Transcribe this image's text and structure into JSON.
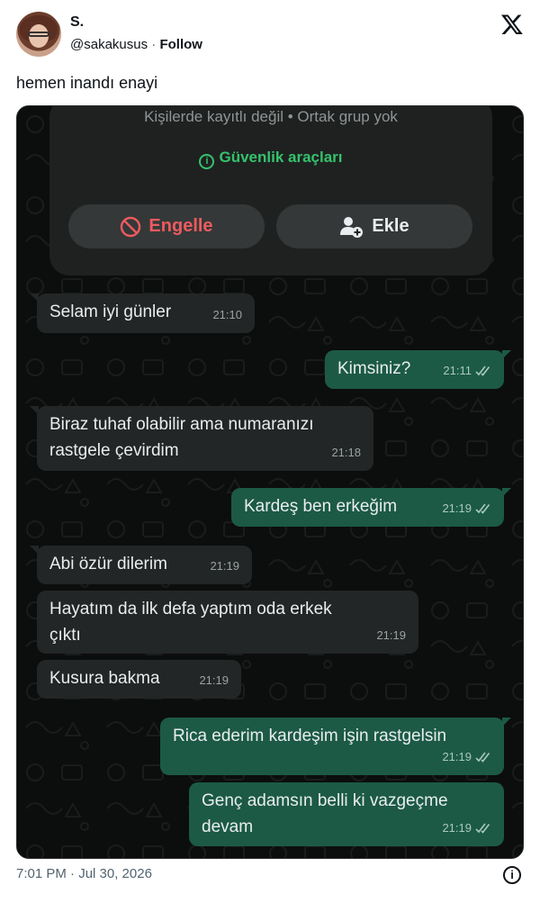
{
  "tweet": {
    "display_name": "S.",
    "handle": "@sakakusus",
    "separator": "·",
    "follow_label": "Follow",
    "text": "hemen inandı enayi",
    "timestamp": "7:01 PM · Jul 30, 2026"
  },
  "chat": {
    "contact_info": "Kişilerde kayıtlı değil • Ortak grup yok",
    "security_label": "Güvenlik araçları",
    "block_label": "Engelle",
    "add_label": "Ekle",
    "messages": [
      {
        "dir": "in",
        "text": "Selam iyi günler",
        "time": "21:10"
      },
      {
        "dir": "out",
        "text": "Kimsiniz?",
        "time": "21:11"
      },
      {
        "dir": "in",
        "text": "Biraz tuhaf olabilir ama numaranızı rastgele çevirdim",
        "line1": "Biraz tuhaf olabilir ama numaranızı",
        "line2": "rastgele çevirdim",
        "time": "21:18"
      },
      {
        "dir": "out",
        "text": "Kardeş ben erkeğim",
        "time": "21:19"
      },
      {
        "dir": "in",
        "text": "Abi özür dilerim",
        "time": "21:19"
      },
      {
        "dir": "in",
        "text": "Hayatım da ilk defa yaptım oda erkek çıktı",
        "line1": "Hayatım da ilk defa yaptım oda erkek",
        "line2": "çıktı",
        "time": "21:19"
      },
      {
        "dir": "in",
        "text": "Kusura bakma",
        "time": "21:19"
      },
      {
        "dir": "out",
        "text": "Rica ederim kardeşim işin rastgelsin",
        "time": "21:19"
      },
      {
        "dir": "out",
        "text": "Genç adamsın belli ki vazgeçme devam",
        "line1": "Genç adamsın belli ki vazgeçme",
        "line2": "devam",
        "time": "21:19"
      }
    ]
  },
  "colors": {
    "incoming_bubble": "#232626",
    "outgoing_bubble": "#1c5a45",
    "security_green": "#35c26c",
    "block_red": "#ec5b5f",
    "chat_background": "#0c0d0d"
  },
  "icons": [
    "x-logo-icon",
    "info-circle-icon",
    "block-icon",
    "add-contact-icon",
    "double-check-icon",
    "tweet-info-icon"
  ]
}
